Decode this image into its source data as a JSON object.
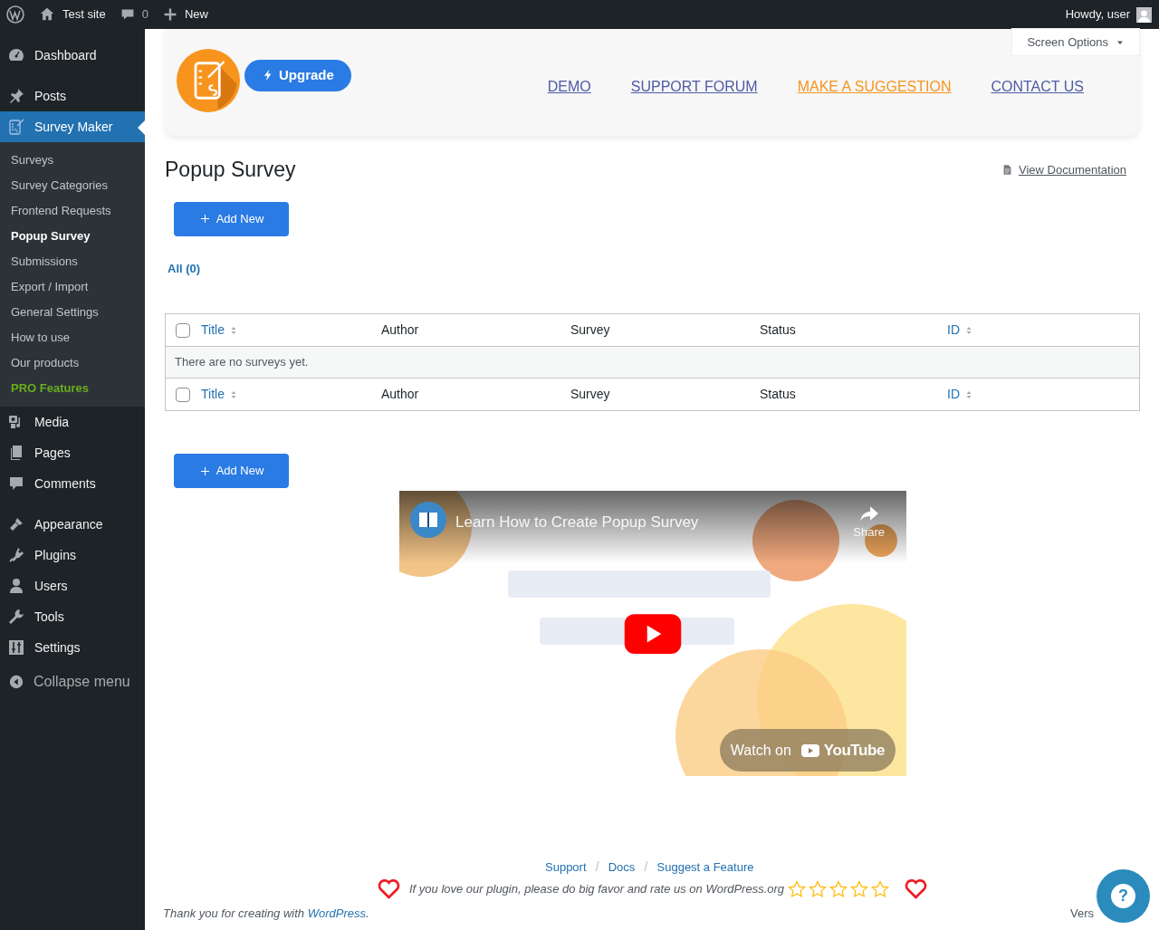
{
  "admin_bar": {
    "site": "Test site",
    "comments": "0",
    "new": "New",
    "greeting": "Howdy, user"
  },
  "sidebar": {
    "groups": [
      [
        {
          "label": "Dashboard",
          "selected": false
        }
      ],
      [
        {
          "label": "Posts",
          "selected": false
        },
        {
          "label": "Survey Maker",
          "selected": true,
          "children": [
            {
              "label": "Surveys",
              "kind": "link",
              "selected": false
            },
            {
              "label": "Survey Categories",
              "kind": "link",
              "selected": false
            },
            {
              "label": "Frontend Requests",
              "kind": "link",
              "selected": false
            },
            {
              "label": "Popup Survey",
              "kind": "link",
              "selected": true
            },
            {
              "label": "Submissions",
              "kind": "link",
              "selected": false
            },
            {
              "label": "Export / Import",
              "kind": "link",
              "selected": false
            },
            {
              "label": "General Settings",
              "kind": "link",
              "selected": false
            },
            {
              "label": "How to use",
              "kind": "link",
              "selected": false
            },
            {
              "label": "Our products",
              "kind": "link",
              "selected": false
            },
            {
              "label": "PRO Features",
              "kind": "pro",
              "selected": false
            }
          ]
        },
        {
          "label": "Media",
          "selected": false
        },
        {
          "label": "Pages",
          "selected": false
        },
        {
          "label": "Comments",
          "selected": false
        }
      ],
      [
        {
          "label": "Appearance",
          "selected": false
        },
        {
          "label": "Plugins",
          "selected": false
        },
        {
          "label": "Users",
          "selected": false
        },
        {
          "label": "Tools",
          "selected": false
        },
        {
          "label": "Settings",
          "selected": false
        }
      ]
    ],
    "collapse": "Collapse menu"
  },
  "screen_options": "Screen Options",
  "header": {
    "upgrade": "Upgrade",
    "nav": [
      {
        "label": "DEMO",
        "highlighted": false
      },
      {
        "label": "SUPPORT FORUM",
        "highlighted": false
      },
      {
        "label": "MAKE A SUGGESTION",
        "highlighted": true
      },
      {
        "label": "CONTACT US",
        "highlighted": false
      }
    ]
  },
  "page_title": "Popup Survey",
  "view_docs": "View Documentation",
  "add_new_top": "Add New",
  "filters": [
    {
      "label": "All (0)",
      "selected": true
    }
  ],
  "table": {
    "header_checked": false,
    "footer_checked": false,
    "header": [
      {
        "label": "Title",
        "sortable": true
      },
      {
        "label": "Author",
        "sortable": false
      },
      {
        "label": "Survey",
        "sortable": false
      },
      {
        "label": "Status",
        "sortable": false
      },
      {
        "label": "ID",
        "sortable": true
      }
    ],
    "empty": "There are no surveys yet.",
    "footer": [
      {
        "label": "Title",
        "sortable": true
      },
      {
        "label": "Author",
        "sortable": false
      },
      {
        "label": "Survey",
        "sortable": false
      },
      {
        "label": "Status",
        "sortable": false
      },
      {
        "label": "ID",
        "sortable": true
      }
    ]
  },
  "add_new_bottom": "Add New",
  "video": {
    "kind": "picture",
    "title": "Learn How to Create Popup Survey",
    "share": "Share",
    "watch_on": "Watch on",
    "brand": "YouTube"
  },
  "footer": {
    "links": [
      "Support",
      "Docs",
      "Suggest a Feature"
    ],
    "separator": "/",
    "rating_text": "If you love our plugin, please do big favor and rate us on WordPress.org",
    "stars": 0,
    "thanks": {
      "before": "Thank you for creating with ",
      "link": "WordPress",
      "after": "."
    },
    "version": "Vers",
    "help": "?"
  }
}
